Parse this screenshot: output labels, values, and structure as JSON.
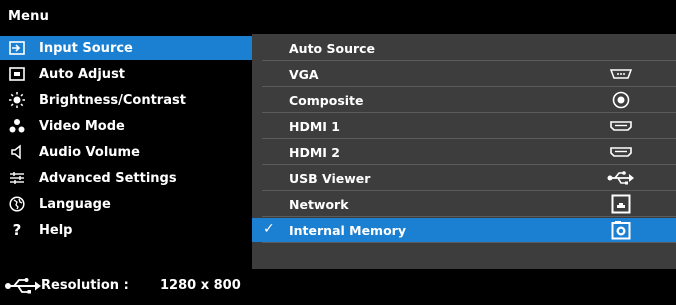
{
  "header": {
    "title": "Menu"
  },
  "menu": {
    "items": [
      {
        "label": "Input Source",
        "icon": "input-source-icon",
        "selected": true
      },
      {
        "label": "Auto Adjust",
        "icon": "auto-adjust-icon",
        "selected": false
      },
      {
        "label": "Brightness/Contrast",
        "icon": "brightness-icon",
        "selected": false
      },
      {
        "label": "Video Mode",
        "icon": "video-mode-icon",
        "selected": false
      },
      {
        "label": "Audio Volume",
        "icon": "speaker-icon",
        "selected": false
      },
      {
        "label": "Advanced Settings",
        "icon": "advanced-settings-icon",
        "selected": false
      },
      {
        "label": "Language",
        "icon": "language-icon",
        "selected": false
      },
      {
        "label": "Help",
        "icon": "help-icon",
        "selected": false
      }
    ]
  },
  "sources": {
    "items": [
      {
        "label": "Auto Source",
        "icon": "",
        "checked": false,
        "selected": false
      },
      {
        "label": "VGA",
        "icon": "vga-icon",
        "checked": false,
        "selected": false
      },
      {
        "label": "Composite",
        "icon": "composite-icon",
        "checked": false,
        "selected": false
      },
      {
        "label": "HDMI 1",
        "icon": "hdmi-icon",
        "checked": false,
        "selected": false
      },
      {
        "label": "HDMI 2",
        "icon": "hdmi-icon",
        "checked": false,
        "selected": false
      },
      {
        "label": "USB Viewer",
        "icon": "usb-icon",
        "checked": false,
        "selected": false
      },
      {
        "label": "Network",
        "icon": "network-icon",
        "checked": false,
        "selected": false
      },
      {
        "label": "Internal Memory",
        "icon": "internal-memory-icon",
        "checked": true,
        "selected": true
      }
    ],
    "check_mark": "✓"
  },
  "status": {
    "resolution_label": "Resolution :",
    "resolution_value": "1280 x 800",
    "icon": "usb-icon"
  },
  "colors": {
    "highlight": "#1b7fd2",
    "panel_background": "#3d3d3d",
    "background": "#000000",
    "text": "#ffffff"
  }
}
